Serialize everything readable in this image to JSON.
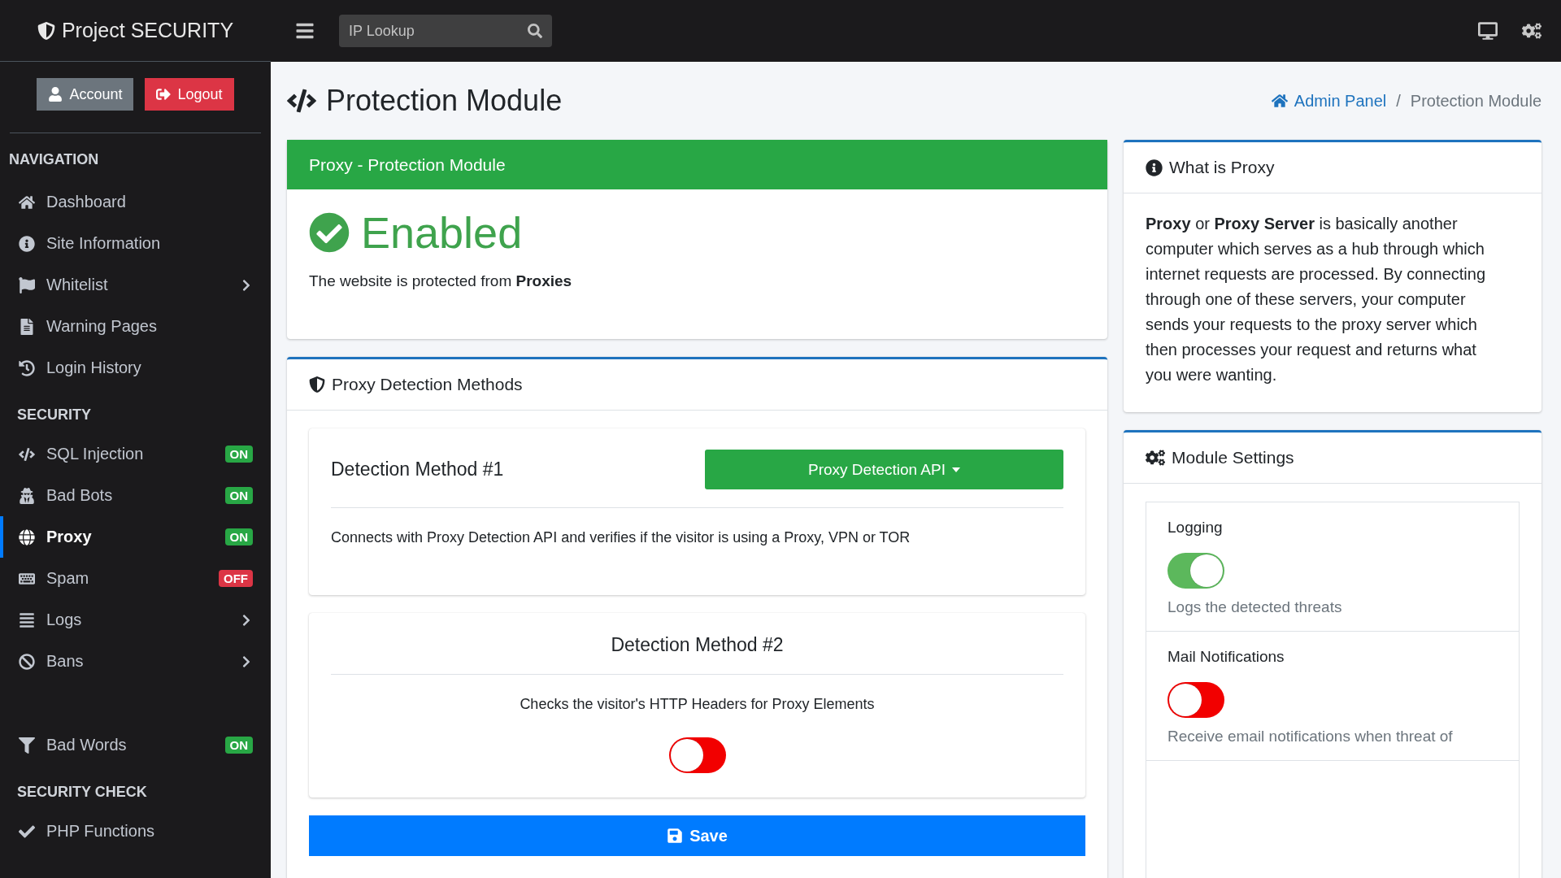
{
  "brand": {
    "name": "Project SECURITY"
  },
  "topbar": {
    "search": {
      "placeholder": "IP Lookup"
    }
  },
  "account_buttons": [
    {
      "label": "Account",
      "kind": "account"
    },
    {
      "label": "Logout",
      "kind": "logout"
    }
  ],
  "sidebar": {
    "sections": [
      {
        "title": "NAVIGATION",
        "items": [
          {
            "label": "Dashboard",
            "selected": false,
            "expandable": false
          },
          {
            "label": "Site Information",
            "selected": false,
            "expandable": false
          },
          {
            "label": "Whitelist",
            "selected": false,
            "expandable": true
          },
          {
            "label": "Warning Pages",
            "selected": false,
            "expandable": false
          },
          {
            "label": "Login History",
            "selected": false,
            "expandable": false
          }
        ]
      },
      {
        "title": "SECURITY",
        "items": [
          {
            "label": "SQL Injection",
            "selected": false,
            "expandable": false,
            "badge": "ON",
            "on": true
          },
          {
            "label": "Bad Bots",
            "selected": false,
            "expandable": false,
            "badge": "ON",
            "on": true
          },
          {
            "label": "Proxy",
            "selected": true,
            "expandable": false,
            "badge": "ON",
            "on": true
          },
          {
            "label": "Spam",
            "selected": false,
            "expandable": false,
            "badge": "OFF",
            "on": false
          },
          {
            "label": "Logs",
            "selected": false,
            "expandable": true
          },
          {
            "label": "Bans",
            "selected": false,
            "expandable": true
          },
          {
            "label": "Bad Words",
            "selected": false,
            "expandable": false,
            "badge": "ON",
            "on": true,
            "gap_before": true
          }
        ]
      },
      {
        "title": "SECURITY CHECK",
        "items": [
          {
            "label": "PHP Functions",
            "selected": false,
            "expandable": false
          }
        ]
      }
    ]
  },
  "page": {
    "title": "Protection Module",
    "breadcrumb": [
      {
        "label": "Admin Panel",
        "kind": "link"
      },
      {
        "label": "Protection Module",
        "kind": "current"
      }
    ],
    "breadcrumb_separator": "/"
  },
  "status_card": {
    "header": "Proxy - Protection Module",
    "enabled": true,
    "status": "Enabled",
    "description": "The website is protected from **Proxies**"
  },
  "methods_card": {
    "title": "Proxy Detection Methods",
    "methods": [
      {
        "kind": "dropdown",
        "title": "Detection Method #1",
        "button": "Proxy Detection API",
        "description": "Connects with Proxy Detection API and verifies if the visitor is using a Proxy, VPN or TOR"
      },
      {
        "kind": "toggle",
        "title": "Detection Method #2",
        "description": "Checks the visitor's HTTP Headers for Proxy Elements",
        "on": false
      }
    ],
    "save": "Save"
  },
  "info_card": {
    "title": "What is Proxy",
    "text": "**Proxy** or **Proxy Server** is basically another computer which serves as a hub through which internet requests are processed. By connecting through one of these servers, your computer sends your requests to the proxy server which then processes your request and returns what you were wanting."
  },
  "settings_card": {
    "title": "Module Settings",
    "settings": [
      {
        "label": "Logging",
        "on": true,
        "description": "Logs the detected threats"
      },
      {
        "label": "Mail Notifications",
        "on": false,
        "description": "Receive email notifications when threat of"
      }
    ]
  }
}
